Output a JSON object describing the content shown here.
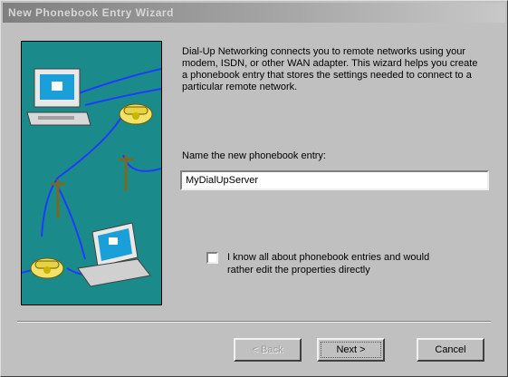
{
  "window": {
    "title": "New Phonebook Entry Wizard"
  },
  "illustration": {
    "icons": [
      "computer-icon",
      "telephone-icon",
      "telephone-pole-icon",
      "laptop-icon",
      "telephone-icon"
    ],
    "colors": {
      "background": "#1b8a8a",
      "wire": "#1e3cff"
    }
  },
  "content": {
    "description": "Dial-Up Networking connects you to remote networks using your modem, ISDN, or other WAN adapter. This wizard helps you create a phonebook entry that stores the settings needed to connect to a particular remote network.",
    "name_label": "Name the new phonebook entry:",
    "name_value": "MyDialUpServer",
    "checkbox_label": "I know all about phonebook entries and would rather edit the properties directly",
    "checkbox_checked": false
  },
  "buttons": {
    "back": "< Back",
    "next": "Next >",
    "cancel": "Cancel"
  }
}
